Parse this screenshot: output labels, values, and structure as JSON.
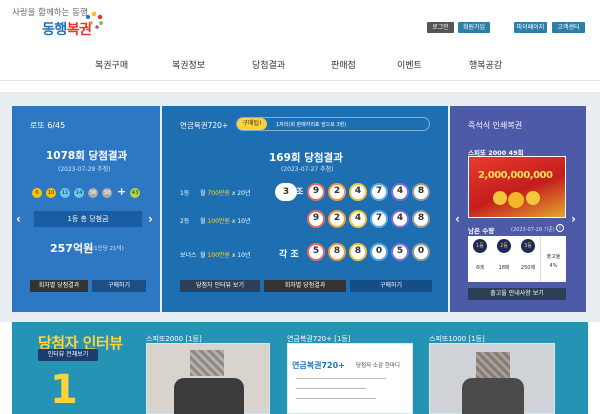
{
  "header": {
    "tagline": "사랑을 함께하는 동행",
    "logo_a": "동행",
    "logo_b": "복권",
    "buttons": {
      "login": "로그인",
      "join": "회원가입",
      "mypage": "마이페이지",
      "cs": "고객센터"
    }
  },
  "nav": [
    "복권구매",
    "복권정보",
    "당첨결과",
    "판매점",
    "이벤트",
    "행복공감"
  ],
  "lotto": {
    "title": "로또 6/45",
    "round": "1078회 당첨결과",
    "date": "(2023-07-29 추첨)",
    "numbers": [
      "6",
      "10",
      "11",
      "14",
      "36",
      "38"
    ],
    "plus": "+",
    "bonus": "43",
    "first_prize_label": "1등 총 당첨금",
    "prize": "257억원",
    "prize_detail": "(1인당 21억)",
    "btn_results": "회차별 당첨결과",
    "btn_buy": "구매하기"
  },
  "pension": {
    "title": "연금복권720+",
    "badge": "구매팁!",
    "tip": "1자리(회 판매자리표 앞으로 3장)",
    "round": "169회 당첨결과",
    "date": "(2023-07-27 추첨)",
    "rows": [
      {
        "rank": "1등",
        "desc_a": "월 ",
        "amount": "700만원",
        "desc_b": " x 20년",
        "group": "3",
        "group_unit": "조",
        "digits": [
          "9",
          "2",
          "4",
          "7",
          "4",
          "8"
        ]
      },
      {
        "rank": "2등",
        "desc_a": "월 ",
        "amount": "100만원",
        "desc_b": " x 10년",
        "group": "",
        "group_unit": "",
        "digits": [
          "9",
          "2",
          "4",
          "7",
          "4",
          "8"
        ]
      },
      {
        "rank": "보너스",
        "desc_a": "월 ",
        "amount": "100만원",
        "desc_b": " x 10년",
        "group": "각 조",
        "group_unit": "",
        "digits": [
          "5",
          "8",
          "8",
          "0",
          "5",
          "0"
        ]
      }
    ],
    "btn_interview": "당첨자 인터뷰 보기",
    "btn_results": "회차별 당첨결과",
    "btn_buy": "구매하기"
  },
  "instant": {
    "title": "즉석식 인쇄복권",
    "game": "스피또 2000 49회",
    "jackpot": "2,000,000,000",
    "remain_label": "남은 수량",
    "remain_date": "(2023-07-28 기준)",
    "prizes": [
      {
        "rank": "1등",
        "count": "6매"
      },
      {
        "rank": "2등",
        "count": "18매"
      },
      {
        "rank": "3등",
        "count": "250매"
      }
    ],
    "ratio": "출고율",
    "ratio_value": "4%",
    "btn_notice": "출고율 안내사항 보기"
  },
  "interview": {
    "title": "당첨자 인터뷰",
    "btn_all": "인터뷰 전체보기",
    "cards": [
      "스피또2000 [1등]",
      "연금복권720+ [1등]",
      "스피또1000 [1등]"
    ],
    "card2_logo": "연금복권720+",
    "card2_text": "당첨자 소감 한마디"
  },
  "colors": {
    "blue": "#1e73be",
    "red": "#e3342f",
    "lotto_panel": "#2e78c3",
    "pension_panel": "#1d6fb1",
    "instant_panel": "#4c5aa8",
    "yellow": "#ffd23a"
  }
}
